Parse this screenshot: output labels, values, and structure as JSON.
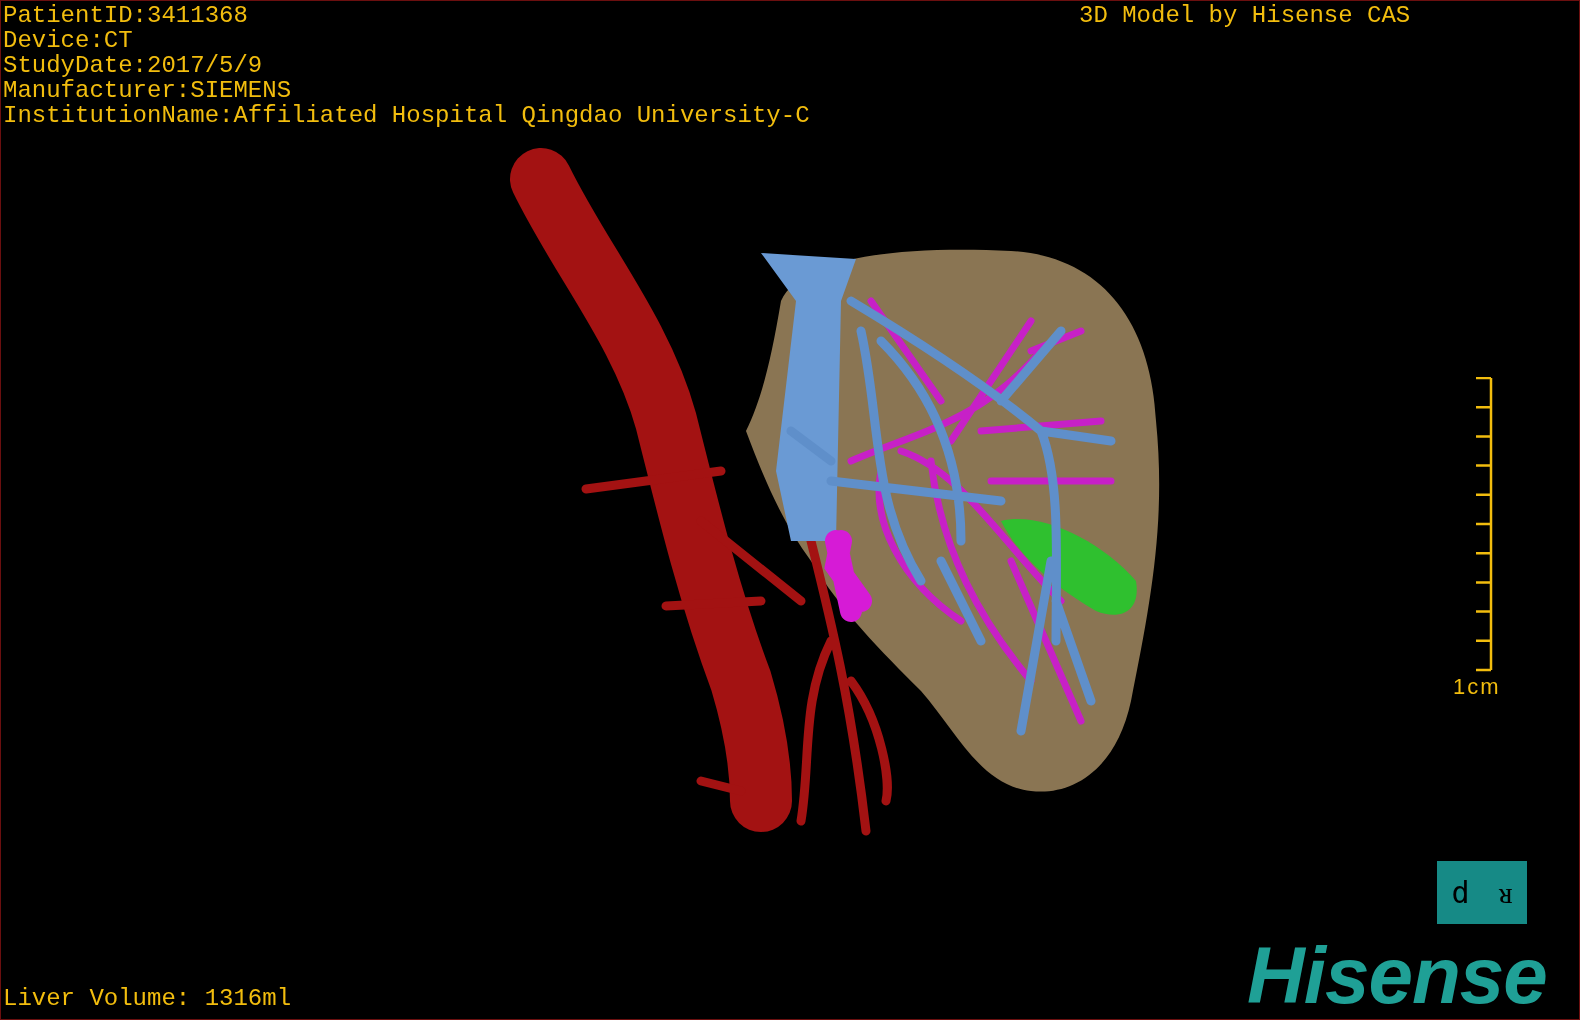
{
  "patient_info": [
    "PatientID:3411368",
    "Device:CT",
    "StudyDate:2017/5/9",
    "Manufacturer:SIEMENS",
    "InstitutionName:Affiliated Hospital Qingdao University-C"
  ],
  "title": "3D Model by Hisense CAS",
  "scale_bar": {
    "label": "1cm"
  },
  "orientation_cube": {
    "labels": [
      "d",
      "ᴚ"
    ]
  },
  "logo": "Hisense",
  "liver_volume": "Liver Volume: 1316ml"
}
